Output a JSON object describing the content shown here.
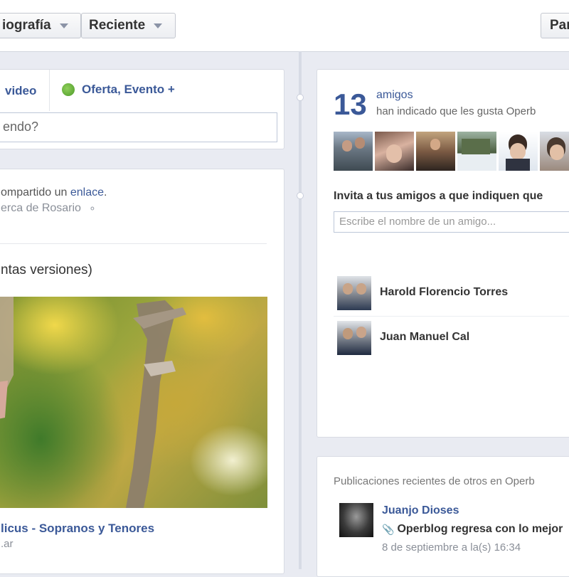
{
  "topbar": {
    "filter1_label": "iografía",
    "filter2_label": "Reciente",
    "right_button_label": "Par"
  },
  "composer": {
    "video_tab": "video",
    "offer_tab": "Oferta, Evento +",
    "placeholder": "endo?"
  },
  "post": {
    "shared_text": "ompartido un",
    "shared_link": "enlace",
    "shared_period": ".",
    "location": "erca de Rosario",
    "message": "ntas versiones)",
    "link_title": "licus - Sopranos y Tenores",
    "link_domain": ".ar"
  },
  "likes_box": {
    "count": "13",
    "amigos": "amigos",
    "subtitle": "han indicado que les gusta Operb",
    "invite_heading": "Invita a tus amigos a que indiquen que",
    "invite_placeholder": "Escribe el nombre de un amigo...",
    "friends": [
      {
        "name": "Harold Florencio Torres"
      },
      {
        "name": "Juan Manuel Cal"
      }
    ]
  },
  "recent_box": {
    "heading": "Publicaciones recientes de otros en Operb",
    "author": "Juanjo Dioses",
    "text": "Operblog regresa con lo mejor",
    "date": "8 de septiembre a la(s) 16:34"
  },
  "colors": {
    "brand_blue": "#3b5998",
    "background": "#e9ebf2"
  }
}
